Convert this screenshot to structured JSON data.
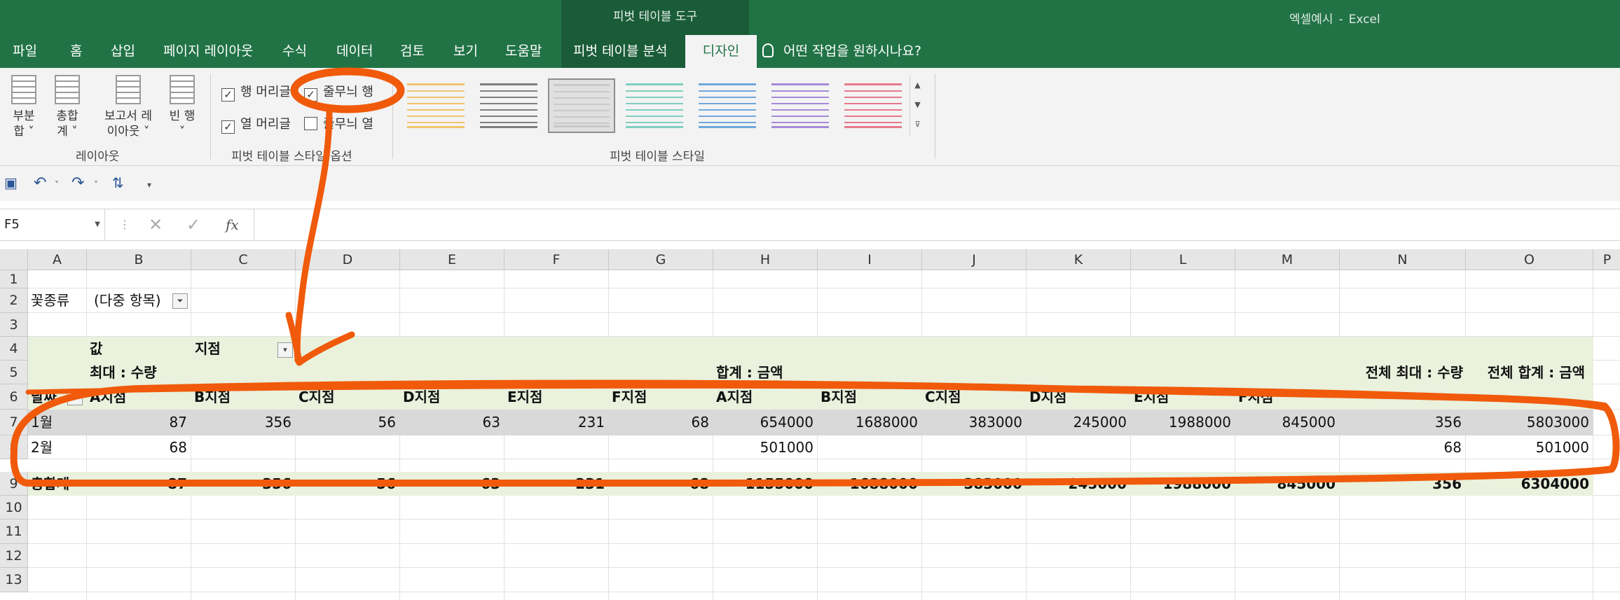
{
  "window": {
    "context_title": "피벗 테이블 도구",
    "doc_title": "엑셀예시",
    "separator": "-",
    "app_name": "Excel"
  },
  "tabs": [
    "파일",
    "홈",
    "삽입",
    "페이지 레이아웃",
    "수식",
    "데이터",
    "검토",
    "보기",
    "도움말",
    "피벗 테이블 분석",
    "디자인"
  ],
  "tell_me": "어떤 작업을 원하시나요?",
  "ribbon": {
    "layout_buttons": [
      {
        "line1": "부분",
        "line2": "합 ˅"
      },
      {
        "line1": "총합",
        "line2": "계 ˅"
      },
      {
        "line1": "보고서 레",
        "line2": "이아웃 ˅"
      },
      {
        "line1": "빈 행",
        "line2": "˅"
      }
    ],
    "layout_group": "레이아웃",
    "options": {
      "row_headers": "행 머리글",
      "banded_rows": "줄무늬 행",
      "col_headers": "열 머리글",
      "banded_cols": "줄무늬 열"
    },
    "options_group": "피벗 테이블 스타일 옵션",
    "styles_group": "피벗 테이블 스타일",
    "style_colors": [
      "#f2c46d",
      "#7f7f7f",
      "#c9c9c9",
      "#7fcfc0",
      "#6fa8dc",
      "#a58ad8",
      "#e67a8b"
    ]
  },
  "formula_bar": {
    "name_box": "F5",
    "fx": "fx",
    "value": ""
  },
  "columns": [
    "A",
    "B",
    "C",
    "D",
    "E",
    "F",
    "G",
    "H",
    "I",
    "J",
    "K",
    "L",
    "M",
    "N",
    "O",
    "P"
  ],
  "rows": [
    "1",
    "2",
    "3",
    "4",
    "5",
    "6",
    "7",
    "8",
    "9",
    "10",
    "11",
    "12",
    "13"
  ],
  "pivot": {
    "filter_label": "꽃종류",
    "filter_value": "(다중 항목)",
    "values_label": "값",
    "col_field": "지점",
    "max_qty": "최대 : 수량",
    "sum_amount": "합계 : 금액",
    "total_max_qty": "전체 최대 : 수량",
    "total_sum_amount": "전체 합계 : 금액",
    "row_field": "날짜",
    "branches": [
      "A지점",
      "B지점",
      "C지점",
      "D지점",
      "E지점",
      "F지점",
      "A지점",
      "B지점",
      "C지점",
      "D지점",
      "E지점",
      "F지점"
    ],
    "data_rows": [
      {
        "label": "1월",
        "values": [
          "87",
          "356",
          "56",
          "63",
          "231",
          "68",
          "654000",
          "1688000",
          "383000",
          "245000",
          "1988000",
          "845000",
          "356",
          "5803000"
        ]
      },
      {
        "label": "2월",
        "values": [
          "68",
          "",
          "",
          "",
          "",
          "",
          "501000",
          "",
          "",
          "",
          "",
          "",
          "68",
          "501000"
        ]
      }
    ],
    "total_row": {
      "label": "총합계",
      "values": [
        "87",
        "356",
        "56",
        "63",
        "231",
        "68",
        "1155000",
        "1688000",
        "383000",
        "245000",
        "1988000",
        "845000",
        "356",
        "6304000"
      ]
    }
  },
  "colors": {
    "excel_green": "#217346",
    "context_green": "#1a5c38",
    "band_green": "#eaf1dd",
    "band_gray": "#d9d9d9",
    "annotation": "#f05a0a"
  }
}
